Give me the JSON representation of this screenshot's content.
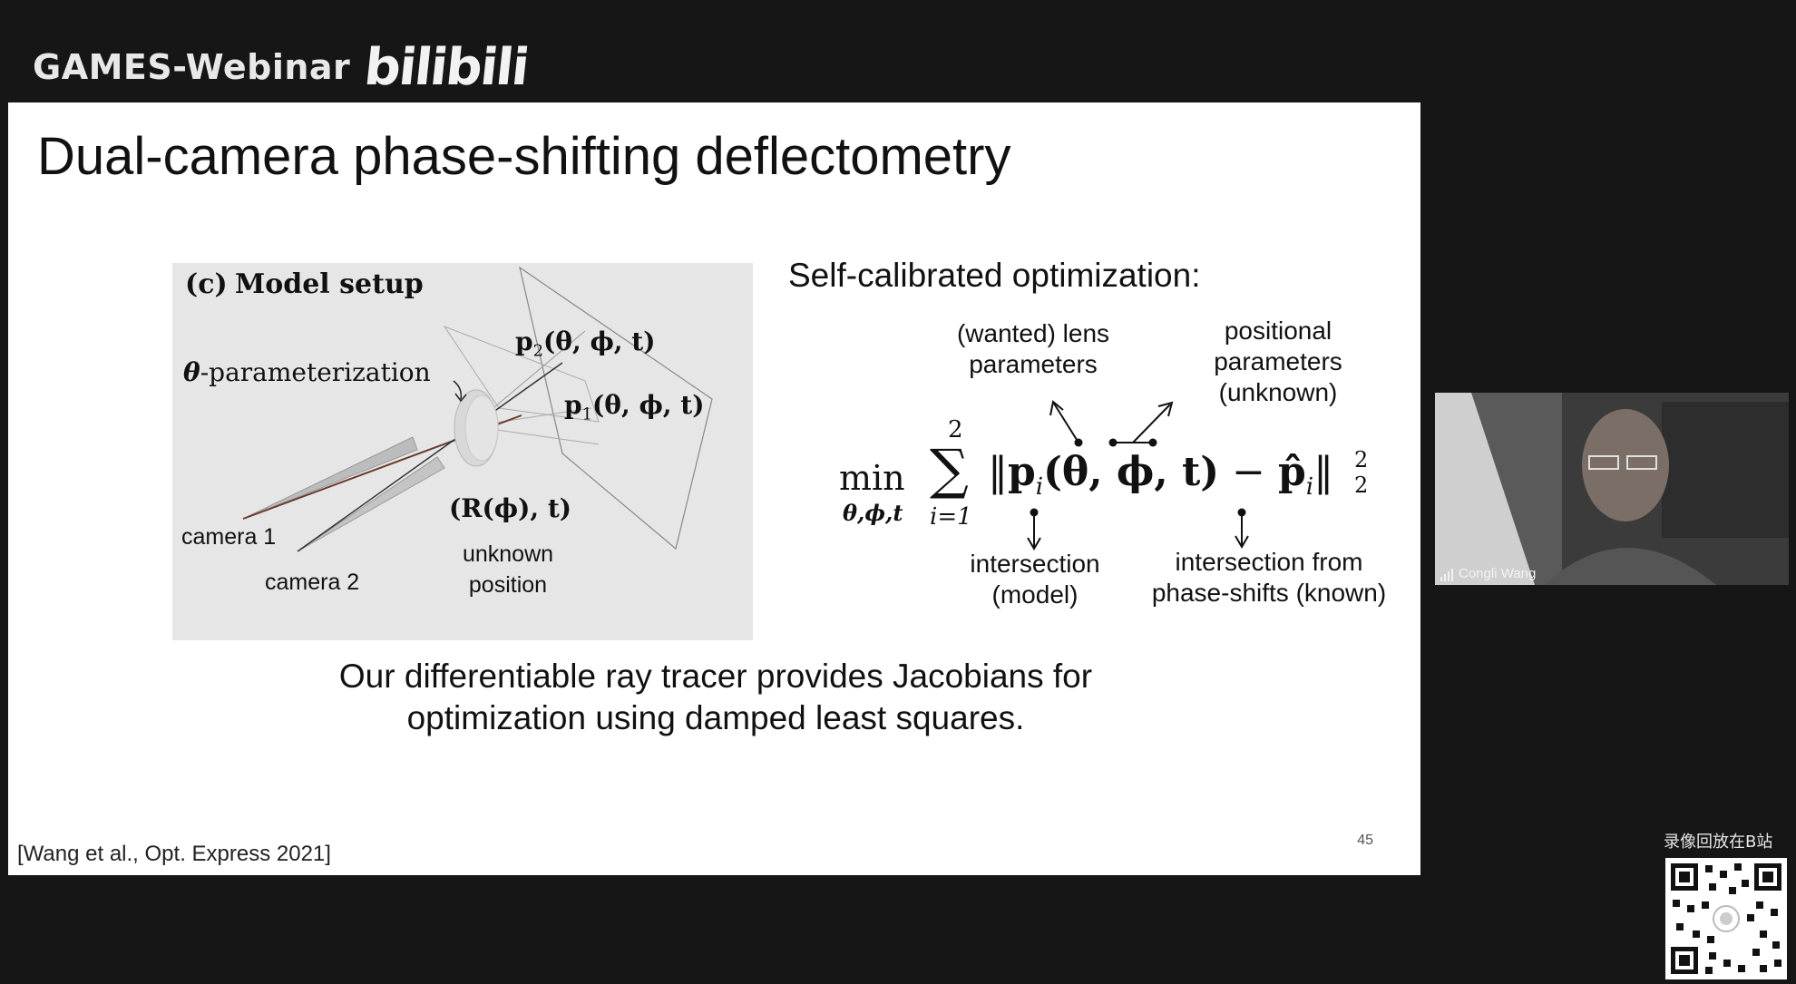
{
  "header": {
    "brand_text": "GAMES-Webinar",
    "logo_text": "bilibili"
  },
  "slide": {
    "title": "Dual-camera phase-shifting deflectometry",
    "figure": {
      "label_c": "(c)",
      "label_model_setup": "Model setup",
      "theta_symbol": "θ",
      "theta_param": "-parameterization",
      "p2": "p",
      "p2_sub": "2",
      "p1": "p",
      "p1_sub": "1",
      "args": "(θ, ϕ, t)",
      "rt": "(R(ϕ), t)",
      "camera1": "camera 1",
      "camera2": "camera 2",
      "unknown": "unknown",
      "position": "position"
    },
    "equation": {
      "heading": "Self-calibrated optimization:",
      "annot_lens_1": "(wanted) lens",
      "annot_lens_2": "parameters",
      "annot_pos_1": "positional",
      "annot_pos_2": "parameters",
      "annot_pos_3": "(unknown)",
      "annot_model_1": "intersection",
      "annot_model_2": "(model)",
      "annot_known_1": "intersection from",
      "annot_known_2": "phase-shifts (known)",
      "min": "min",
      "min_sub": "θ,ϕ,t",
      "sum_top": "2",
      "sum_bottom": "i=1",
      "sigma": "∑",
      "norm_open": "‖",
      "p": "p",
      "sub_i": "i",
      "args": "(θ, ϕ, t)",
      "minus": "−",
      "phat": "p̂",
      "norm_close": "‖",
      "sup2": "2",
      "sub2": "2"
    },
    "caption_line1": "Our differentiable ray tracer provides Jacobians for",
    "caption_line2": "optimization using damped least squares.",
    "citation": "[Wang et al., Opt. Express 2021]",
    "page_number": "45"
  },
  "video": {
    "participant_name": "Congli Wang"
  },
  "replay": {
    "text": "录像回放在B站"
  }
}
